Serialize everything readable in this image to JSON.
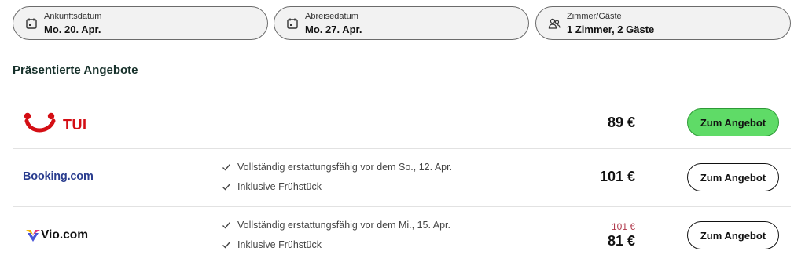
{
  "search": {
    "arrival": {
      "label": "Ankunftsdatum",
      "value": "Mo. 20. Apr.",
      "icon": "calendar-icon"
    },
    "departure": {
      "label": "Abreisedatum",
      "value": "Mo. 27. Apr.",
      "icon": "calendar-icon"
    },
    "rooms": {
      "label": "Zimmer/Gäste",
      "value": "1 Zimmer, 2 Gäste",
      "icon": "guests-icon"
    }
  },
  "section_title": "Präsentierte Angebote",
  "offers": [
    {
      "provider": "TUI",
      "features": [],
      "price": "89 €",
      "button": "Zum Angebot",
      "button_style": "primary"
    },
    {
      "provider": "Booking.com",
      "features": [
        "Vollständig erstattungsfähig vor dem So., 12. Apr.",
        "Inklusive Frühstück"
      ],
      "price": "101 €",
      "button": "Zum Angebot",
      "button_style": "outline"
    },
    {
      "provider": "Vio.com",
      "features": [
        "Vollständig erstattungsfähig vor dem Mi., 15. Apr.",
        "Inklusive Frühstück"
      ],
      "old_price": "101 €",
      "price": "81 €",
      "button": "Zum Angebot",
      "button_style": "outline"
    }
  ],
  "colors": {
    "primary_button": "#5fdb67",
    "tui_red": "#d40e14",
    "booking_blue": "#2a3d8f",
    "old_price": "#b03a4c"
  }
}
